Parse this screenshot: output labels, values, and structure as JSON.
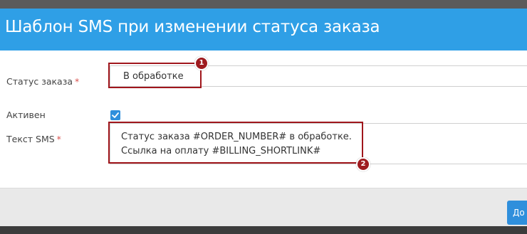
{
  "modal": {
    "title": "Шаблон SMS при изменении статуса заказа"
  },
  "form": {
    "status": {
      "label": "Статус заказа",
      "required_mark": "*",
      "value": "В обработке"
    },
    "active": {
      "label": "Активен",
      "checked": true
    },
    "sms_text": {
      "label": "Текст SMS",
      "required_mark": "*",
      "value": "Статус заказа #ORDER_NUMBER# в обработке.\nСсылка на оплату #BILLING_SHORTLINK#"
    }
  },
  "annotations": {
    "badge_1": "1",
    "badge_2": "2"
  },
  "footer": {
    "primary_button_label": "До"
  },
  "colors": {
    "header": "#2f9fe6",
    "highlight": "#a0161c",
    "checkbox": "#2f8fdc",
    "required": "#d9534f"
  }
}
